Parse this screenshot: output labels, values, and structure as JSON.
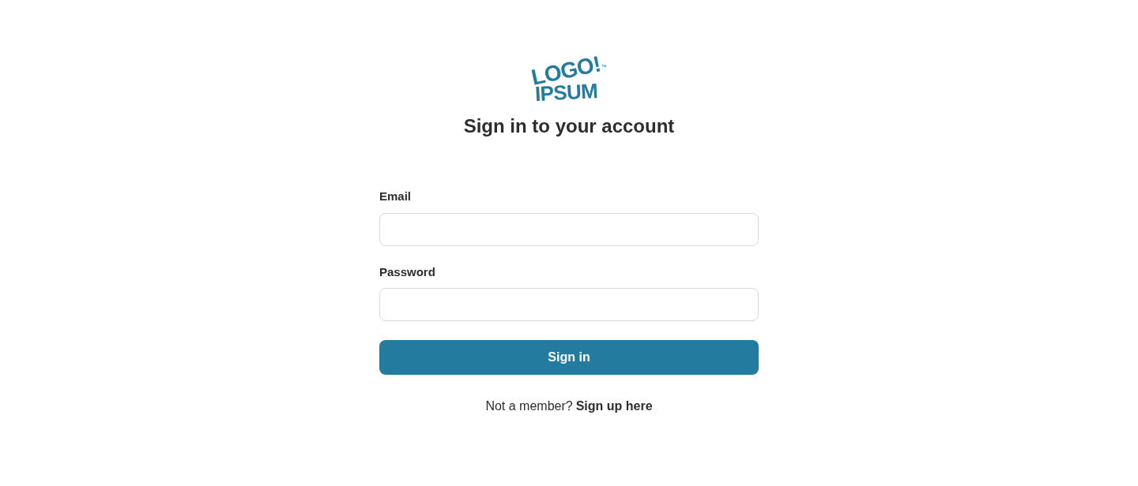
{
  "logo": {
    "line_1": "LOGO!",
    "line_2": "IPSUM",
    "mark": "™"
  },
  "title": "Sign in to your account",
  "fields": [
    {
      "label": "Email"
    },
    {
      "label": "Password"
    }
  ],
  "submit": "Sign in",
  "footer": {
    "text": "Not a member?",
    "link": "Sign up here"
  }
}
